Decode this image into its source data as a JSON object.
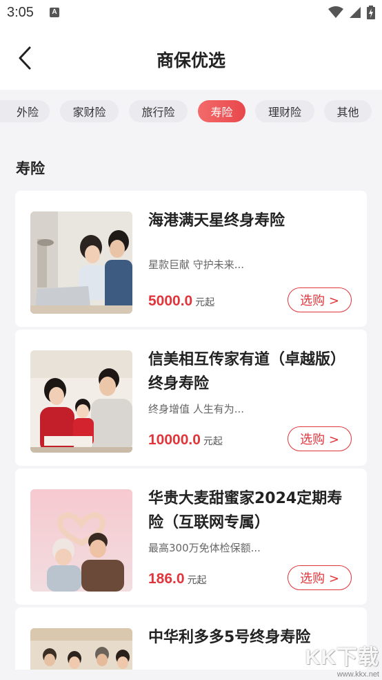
{
  "status_bar": {
    "time": "3:05",
    "left_icon_glyph": "A",
    "left_icon": "text-a-notification-icon",
    "right_icons": [
      "wifi-icon",
      "signal-icon",
      "battery-charging-icon"
    ]
  },
  "header": {
    "title": "商保优选",
    "back_icon": "chevron-left-icon"
  },
  "tabs": [
    {
      "label": "外险",
      "active": false
    },
    {
      "label": "家财险",
      "active": false
    },
    {
      "label": "旅行险",
      "active": false
    },
    {
      "label": "寿险",
      "active": true
    },
    {
      "label": "理财险",
      "active": false
    },
    {
      "label": "其他",
      "active": false
    }
  ],
  "section": {
    "title": "寿险"
  },
  "products": [
    {
      "title": "海港满天星终身寿险",
      "desc": "星款巨献 守护未来...",
      "price": "5000.0",
      "unit": "元起",
      "button": "选购 >",
      "image": "family-at-laptop-photo"
    },
    {
      "title": "信美相互传家有道（卓越版）终身寿险",
      "desc": "终身增值 人生有为...",
      "price": "10000.0",
      "unit": "元起",
      "button": "选购 >",
      "image": "family-portrait-red-sweaters-photo"
    },
    {
      "title": "华贵大麦甜蜜家2024定期寿险（互联网专属）",
      "desc": "最高300万免体检保额...",
      "price": "186.0",
      "unit": "元起",
      "button": "选购 >",
      "image": "couple-heart-hands-photo"
    },
    {
      "title": "中华利多多5号终身寿险",
      "desc": "",
      "price": "",
      "unit": "",
      "button": "",
      "image": "family-group-photo"
    }
  ],
  "watermark": {
    "big": "KK下载",
    "small": "www.kkx.net"
  },
  "colors": {
    "accent": "#e0353b",
    "tab_active_start": "#f36b6b",
    "tab_active_end": "#e8474b",
    "page_bg": "#f4f4f6"
  }
}
